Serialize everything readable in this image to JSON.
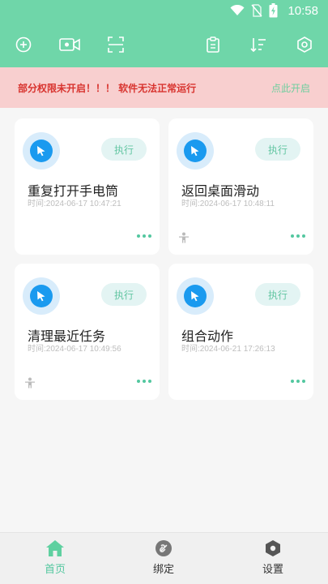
{
  "status_bar": {
    "time": "10:58"
  },
  "colors": {
    "header": "#6fd6a9",
    "accent": "#53c79f",
    "warning_text": "#d8342f",
    "warning_bg": "#f8cfcf",
    "icon_blue": "#1a9aef"
  },
  "toolbar": {
    "left_icons": [
      "add-circle-icon",
      "video-camera-icon",
      "scan-icon"
    ],
    "right_icons": [
      "clipboard-icon",
      "sort-icon",
      "settings-hex-icon"
    ]
  },
  "warning": {
    "text": "部分权限未开启！！！ 软件无法正常运行",
    "action": "点此开启"
  },
  "tasks": [
    {
      "title": "重复打开手电筒",
      "time": "时间:2024-06-17 10:47:21",
      "exec_label": "执行",
      "has_person_icon": false
    },
    {
      "title": "返回桌面滑动",
      "time": "时间:2024-06-17 10:48:11",
      "exec_label": "执行",
      "has_person_icon": true
    },
    {
      "title": "清理最近任务",
      "time": "时间:2024-06-17 10:49:56",
      "exec_label": "执行",
      "has_person_icon": true
    },
    {
      "title": "组合动作",
      "time": "时间:2024-06-21 17:26:13",
      "exec_label": "执行",
      "has_person_icon": false
    }
  ],
  "bottom_nav": [
    {
      "label": "首页",
      "icon": "home-icon",
      "active": true
    },
    {
      "label": "绑定",
      "icon": "link-icon",
      "active": false
    },
    {
      "label": "设置",
      "icon": "settings-icon",
      "active": false
    }
  ]
}
